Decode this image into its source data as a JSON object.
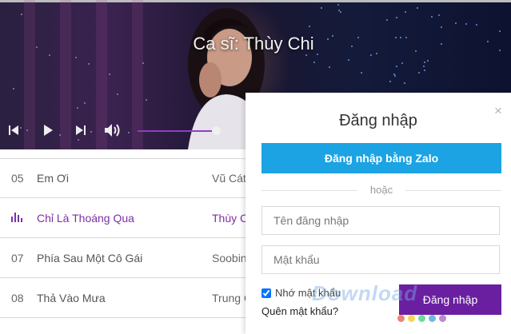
{
  "player": {
    "singer_title": "Ca sĩ: Thùy Chi",
    "progress": 0.98,
    "accent_color": "#8e3fbf",
    "controls": [
      "skip-back-icon",
      "play-icon",
      "skip-forward-icon",
      "volume-icon"
    ]
  },
  "songs": [
    {
      "num": "05",
      "title": "Em Ơi",
      "artist": "Vũ Cát",
      "active": false
    },
    {
      "num": "",
      "title": "Chỉ Là Thoáng Qua",
      "artist": "Thùy C",
      "active": true
    },
    {
      "num": "07",
      "title": "Phía Sau Một Cô Gái",
      "artist": "Soobin",
      "active": false
    },
    {
      "num": "08",
      "title": "Thả Vào Mưa",
      "artist": "Trung Q",
      "active": false
    }
  ],
  "login": {
    "title": "Đăng nhập",
    "zalo_button": "Đăng nhập bằng Zalo",
    "or_text": "hoặc",
    "username_placeholder": "Tên đăng nhập",
    "password_placeholder": "Mật khẩu",
    "remember_label": "Nhớ mật khẩu",
    "remember_checked": true,
    "forgot_link": "Quên mật khẩu?",
    "submit_button": "Đăng nhập",
    "close_glyph": "×",
    "zalo_color": "#1ba3e3",
    "submit_color": "#6a1fa0"
  },
  "watermark": {
    "text": "Download",
    "dot_colors": [
      "#e74c3c",
      "#f1c40f",
      "#2ecc71",
      "#3498db",
      "#9b59b6"
    ]
  }
}
